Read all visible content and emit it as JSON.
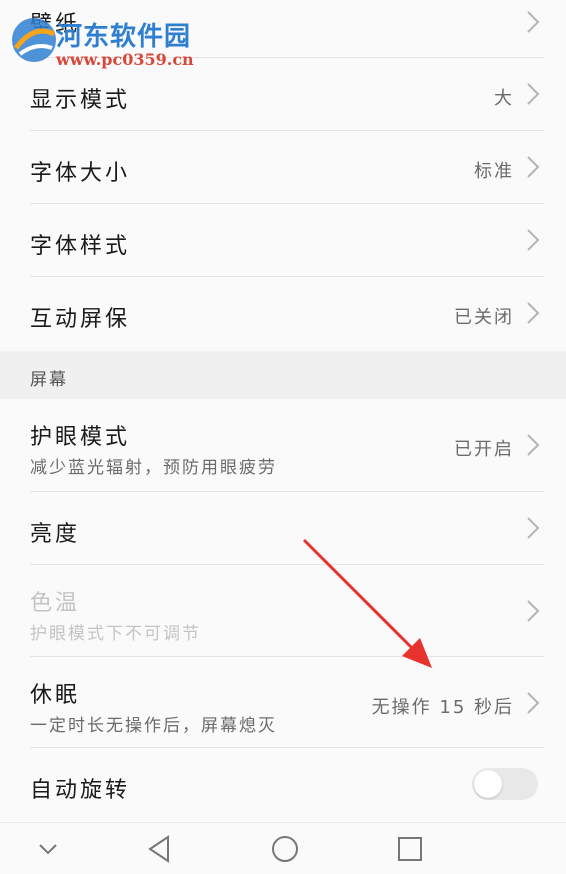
{
  "watermark": {
    "site_name": "河东软件园",
    "url": "www.pc0359.cn"
  },
  "rows": {
    "wallpaper": {
      "title": "壁纸"
    },
    "display_mode": {
      "title": "显示模式",
      "value": "大"
    },
    "font_size": {
      "title": "字体大小",
      "value": "标准"
    },
    "font_style": {
      "title": "字体样式"
    },
    "interactive_screensaver": {
      "title": "互动屏保",
      "value": "已关闭"
    },
    "eye_comfort": {
      "title": "护眼模式",
      "subtitle": "减少蓝光辐射，预防用眼疲劳",
      "value": "已开启"
    },
    "brightness": {
      "title": "亮度"
    },
    "color_temp": {
      "title": "色温",
      "subtitle": "护眼模式下不可调节"
    },
    "sleep": {
      "title": "休眠",
      "subtitle": "一定时长无操作后，屏幕熄灭",
      "value": "无操作 15 秒后"
    },
    "auto_rotate": {
      "title": "自动旋转",
      "toggle_on": false
    }
  },
  "section": {
    "screen_label": "屏幕"
  },
  "annotation": {
    "arrow_color": "#e8322d"
  },
  "navbar": {
    "buttons": [
      "chevron-down-icon",
      "back-triangle-icon",
      "home-circle-icon",
      "recents-square-icon"
    ]
  }
}
